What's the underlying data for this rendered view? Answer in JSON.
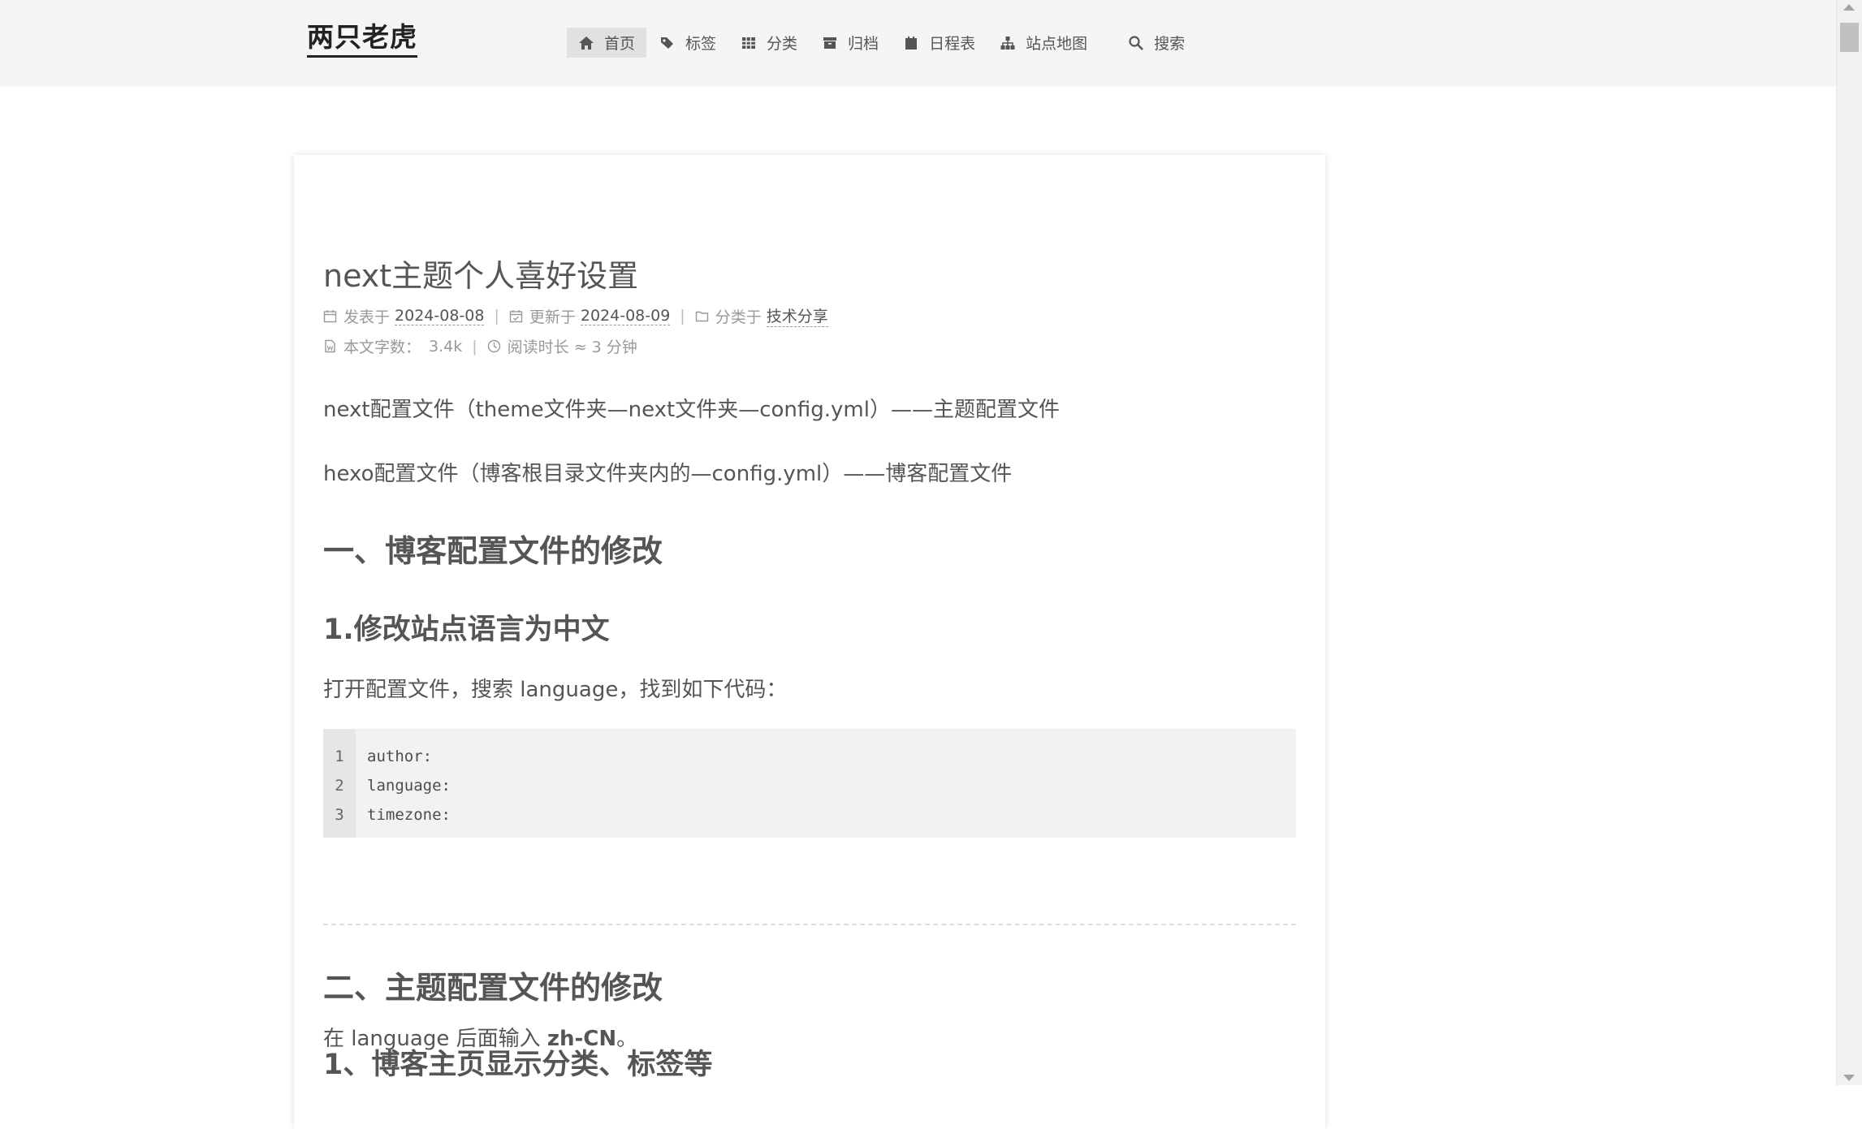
{
  "site": {
    "title": "两只老虎"
  },
  "nav": {
    "items": [
      {
        "label": "首页",
        "icon": "home-icon"
      },
      {
        "label": "标签",
        "icon": "tags-icon"
      },
      {
        "label": "分类",
        "icon": "th-icon"
      },
      {
        "label": "归档",
        "icon": "archive-icon"
      },
      {
        "label": "日程表",
        "icon": "calendar-icon"
      },
      {
        "label": "站点地图",
        "icon": "sitemap-icon"
      },
      {
        "label": "搜索",
        "icon": "search-icon"
      }
    ]
  },
  "post": {
    "title": "next主题个人喜好设置",
    "meta": {
      "posted_label": "发表于",
      "posted_date": "2024-08-08",
      "updated_label": "更新于",
      "updated_date": "2024-08-09",
      "category_label": "分类于",
      "category": "技术分享",
      "wordcount_label": "本文字数：",
      "wordcount": "3.4k",
      "readtime_label": "阅读时长 ≈",
      "readtime": "3 分钟",
      "separator": "|"
    },
    "para1": "next配置文件（theme文件夹—next文件夹—config.yml）——主题配置文件",
    "para2": "hexo配置文件（博客根目录文件夹内的—config.yml）——博客配置文件",
    "h1_1": "一、博客配置文件的修改",
    "h2_1": "1.修改站点语言为中文",
    "para3": "打开配置文件，搜索 language，找到如下代码：",
    "code": {
      "line_numbers": [
        "1",
        "2",
        "3"
      ],
      "lines": [
        "author:",
        "language:",
        "timezone:"
      ]
    },
    "para4_prefix": "在 language 后面输入 ",
    "para4_bold": "zh-CN",
    "para4_suffix": "。",
    "h1_2": "二、主题配置文件的修改",
    "h2_2": "1、博客主页显示分类、标签等"
  }
}
